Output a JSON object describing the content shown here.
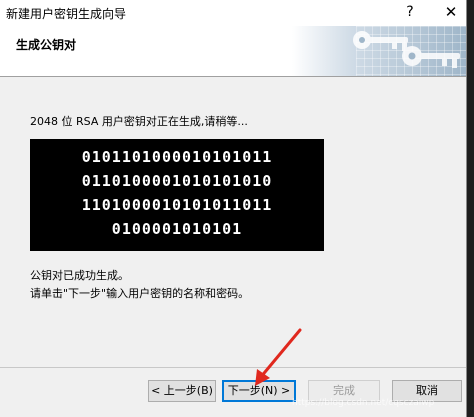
{
  "window": {
    "title": "新建用户密钥生成向导",
    "help_glyph": "?",
    "close_glyph": "✕"
  },
  "header": {
    "title": "生成公钥对"
  },
  "main": {
    "status": "2048 位 RSA 用户密钥对正在生成,请稍等...",
    "bits": [
      "0101101000010101011",
      "0110100001010101010",
      "1101000010101011011",
      "0100001010101"
    ],
    "message_line1": "公钥对已成功生成。",
    "message_line2": "请单击\"下一步\"输入用户密钥的名称和密码。"
  },
  "buttons": {
    "back": "< 上一步(B)",
    "next": "下一步(N) >",
    "finish": "完成",
    "cancel": "取消"
  },
  "watermark": "https://blog.csdn.net/cqsczaiwp",
  "colors": {
    "arrow": "#e0281e",
    "focus": "#0078d7"
  }
}
